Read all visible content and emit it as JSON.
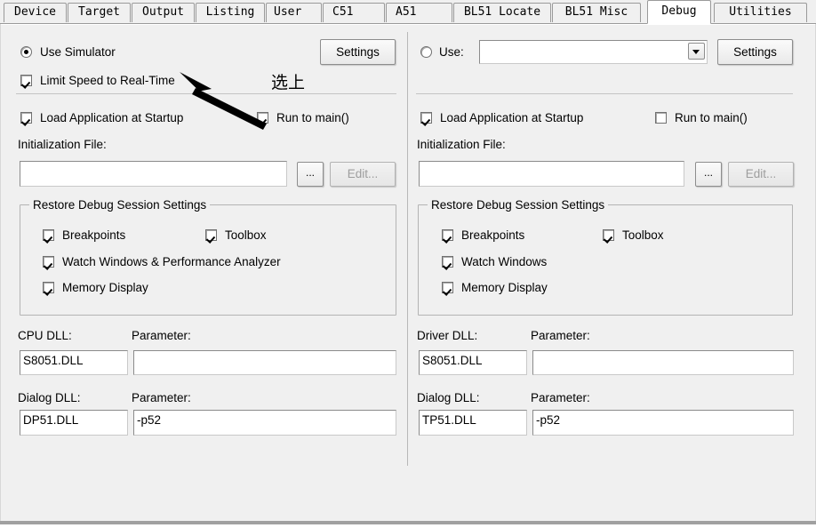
{
  "tabs": [
    {
      "label": "Device",
      "active": false
    },
    {
      "label": "Target",
      "active": false
    },
    {
      "label": "Output",
      "active": false
    },
    {
      "label": "Listing",
      "active": false
    },
    {
      "label": "User",
      "active": false
    },
    {
      "label": "C51",
      "active": false
    },
    {
      "label": "A51",
      "active": false
    },
    {
      "label": "BL51 Locate",
      "active": false
    },
    {
      "label": "BL51 Misc",
      "active": false
    },
    {
      "label": "Debug",
      "active": true
    },
    {
      "label": "Utilities",
      "active": false
    }
  ],
  "left_panel": {
    "mode_radio_label": "Use Simulator",
    "mode_radio_checked": true,
    "settings_button": "Settings",
    "limit_speed_label": "Limit Speed to Real-Time",
    "limit_speed_checked": true,
    "load_app_label": "Load Application at Startup",
    "load_app_checked": true,
    "run_to_main_label": "Run to main()",
    "run_to_main_checked": true,
    "init_file_label": "Initialization File:",
    "init_file_value": "",
    "browse_button": "...",
    "edit_button": "Edit...",
    "edit_button_disabled": true,
    "restore_group_title": "Restore Debug Session Settings",
    "restore_items": [
      {
        "label": "Breakpoints",
        "checked": true
      },
      {
        "label": "Toolbox",
        "checked": true
      },
      {
        "label": "Watch Windows & Performance Analyzer",
        "checked": true
      },
      {
        "label": "Memory Display",
        "checked": true
      }
    ],
    "cpu_dll_label": "CPU DLL:",
    "cpu_dll_value": "S8051.DLL",
    "cpu_param_label": "Parameter:",
    "cpu_param_value": "",
    "dialog_dll_label": "Dialog DLL:",
    "dialog_dll_value": "DP51.DLL",
    "dialog_param_label": "Parameter:",
    "dialog_param_value": "-p52"
  },
  "right_panel": {
    "mode_radio_label": "Use:",
    "mode_radio_checked": false,
    "driver_combo_value": "",
    "settings_button": "Settings",
    "load_app_label": "Load Application at Startup",
    "load_app_checked": true,
    "run_to_main_label": "Run to main()",
    "run_to_main_checked": false,
    "init_file_label": "Initialization File:",
    "init_file_value": "",
    "browse_button": "...",
    "edit_button": "Edit...",
    "edit_button_disabled": true,
    "restore_group_title": "Restore Debug Session Settings",
    "restore_items": [
      {
        "label": "Breakpoints",
        "checked": true
      },
      {
        "label": "Toolbox",
        "checked": true
      },
      {
        "label": "Watch Windows",
        "checked": true
      },
      {
        "label": "Memory Display",
        "checked": true
      }
    ],
    "driver_dll_label": "Driver DLL:",
    "driver_dll_value": "S8051.DLL",
    "driver_param_label": "Parameter:",
    "driver_param_value": "",
    "dialog_dll_label": "Dialog DLL:",
    "dialog_dll_value": "TP51.DLL",
    "dialog_param_label": "Parameter:",
    "dialog_param_value": "-p52"
  },
  "annotation": {
    "note_text": "选上",
    "arrow_color": "#000000"
  }
}
